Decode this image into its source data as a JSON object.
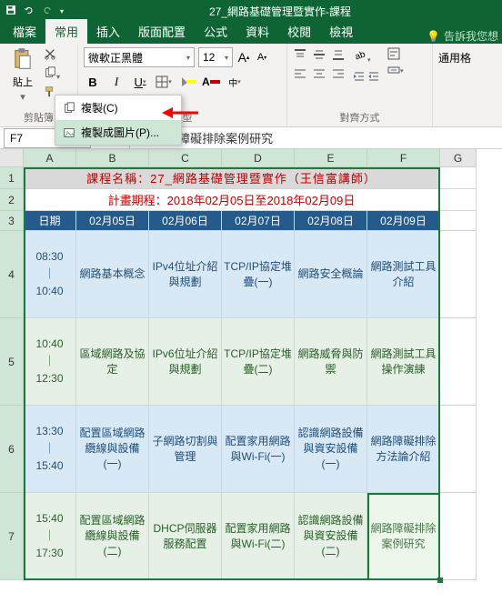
{
  "titlebar": {
    "title": "27_網路基礎管理暨實作-課程"
  },
  "tabs": {
    "file": "檔案",
    "home": "常用",
    "insert": "插入",
    "layout": "版面配置",
    "formulas": "公式",
    "data": "資料",
    "review": "校閱",
    "view": "檢視",
    "tell": "告訴我您想"
  },
  "ribbon": {
    "paste": "貼上",
    "clipboard": "剪貼簿",
    "font_name": "微軟正黑體",
    "font_size": "12",
    "font_group": "字型",
    "align_group": "對齊方式",
    "general": "通用格"
  },
  "copy_menu": {
    "copy": "複製(C)",
    "copy_pic": "複製成圖片(P)..."
  },
  "namebox": "F7",
  "formula": "網路障礙排除案例研究",
  "cols": [
    "A",
    "B",
    "C",
    "D",
    "E",
    "F",
    "G"
  ],
  "rows": [
    "1",
    "2",
    "3",
    "4",
    "5",
    "6",
    "7"
  ],
  "schedule": {
    "title": "課程名稱：27_網路基礎管理暨實作（王信富講師）",
    "subtitle": "計畫期程：2018年02月05日至2018年02月09日",
    "date_label": "日期",
    "dates": [
      "02月05日",
      "02月06日",
      "02月07日",
      "02月08日",
      "02月09日"
    ],
    "times": [
      "08:30\n｜\n10:40",
      "10:40\n｜\n12:30",
      "13:30\n｜\n15:40",
      "15:40\n｜\n17:30"
    ],
    "slots": [
      [
        "網路基本概念",
        "IPv4位址介紹與規劃",
        "TCP/IP協定堆疊(一)",
        "網路安全概論",
        "網路測試工具介紹"
      ],
      [
        "區域網路及協定",
        "IPv6位址介紹與規劃",
        "TCP/IP協定堆疊(二)",
        "網路威脅與防禦",
        "網路測試工具操作演練"
      ],
      [
        "配置區域網路纜線與設備(一)",
        "子網路切割與管理",
        "配置家用網路與Wi-Fi(一)",
        "認識網路設備與資安設備(一)",
        "網路障礙排除方法論介紹"
      ],
      [
        "配置區域網路纜線與設備(二)",
        "DHCP伺服器服務配置",
        "配置家用網路與Wi-Fi(二)",
        "認識網路設備與資安設備(二)",
        "網路障礙排除案例研究"
      ]
    ]
  }
}
